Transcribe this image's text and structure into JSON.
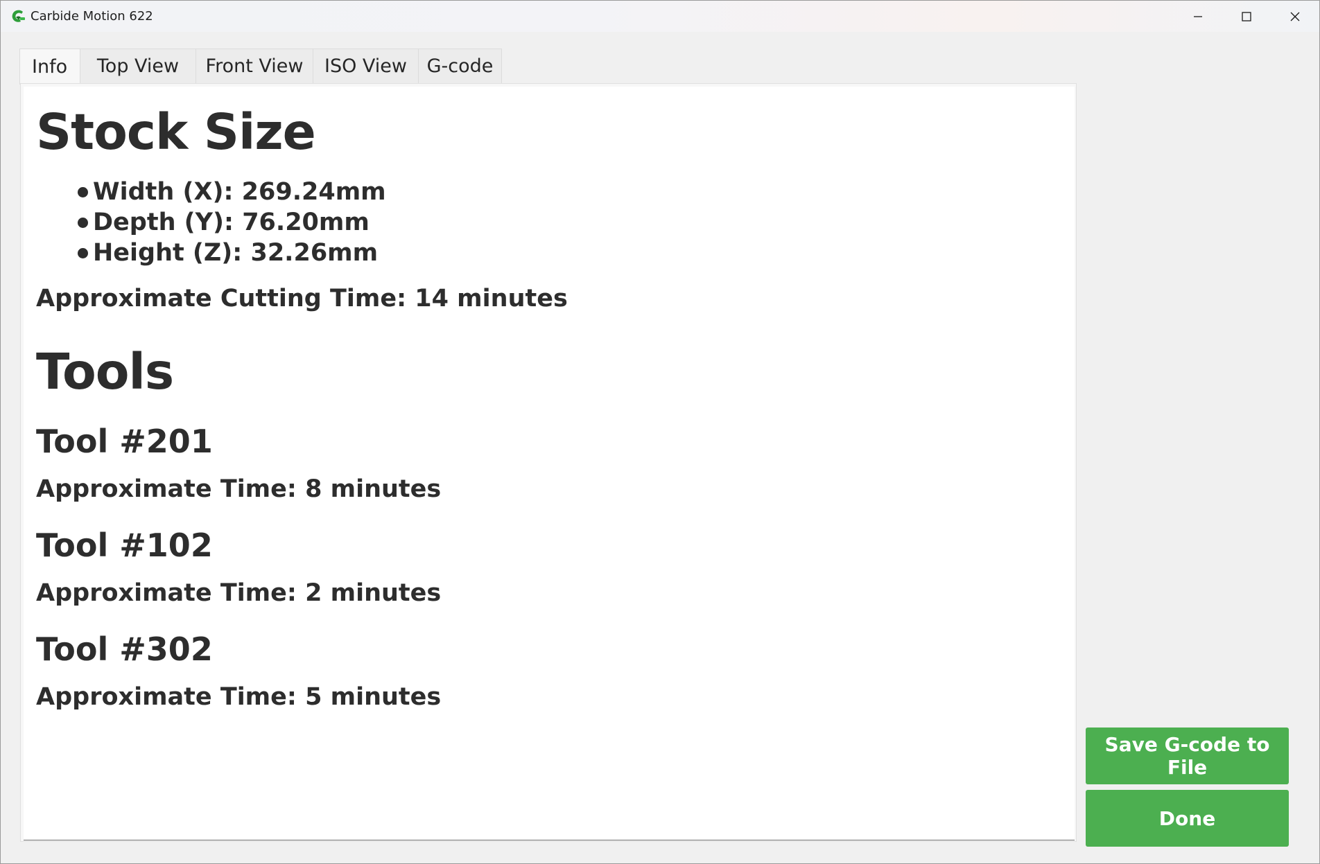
{
  "window": {
    "title": "Carbide Motion 622",
    "accent_color": "#4caf50"
  },
  "icons": {
    "app": "carbide-motion-app-icon",
    "minimize": "minimize-icon",
    "maximize": "maximize-icon",
    "close": "close-icon"
  },
  "tabs": [
    {
      "label": "Info",
      "active": true
    },
    {
      "label": "Top View",
      "active": false
    },
    {
      "label": "Front View",
      "active": false
    },
    {
      "label": "ISO View",
      "active": false
    },
    {
      "label": "G-code",
      "active": false
    }
  ],
  "info": {
    "stock_heading": "Stock Size",
    "stock_items": [
      "Width (X): 269.24mm",
      "Depth (Y): 76.20mm",
      "Height (Z): 32.26mm"
    ],
    "cutting_time": "Approximate Cutting Time: 14 minutes",
    "tools_heading": "Tools",
    "tools": [
      {
        "name": "Tool #201",
        "time": "Approximate Time: 8 minutes"
      },
      {
        "name": "Tool #102",
        "time": "Approximate Time: 2 minutes"
      },
      {
        "name": "Tool #302",
        "time": "Approximate Time: 5 minutes"
      }
    ]
  },
  "actions": {
    "save_label": "Save G-code to File",
    "done_label": "Done"
  }
}
